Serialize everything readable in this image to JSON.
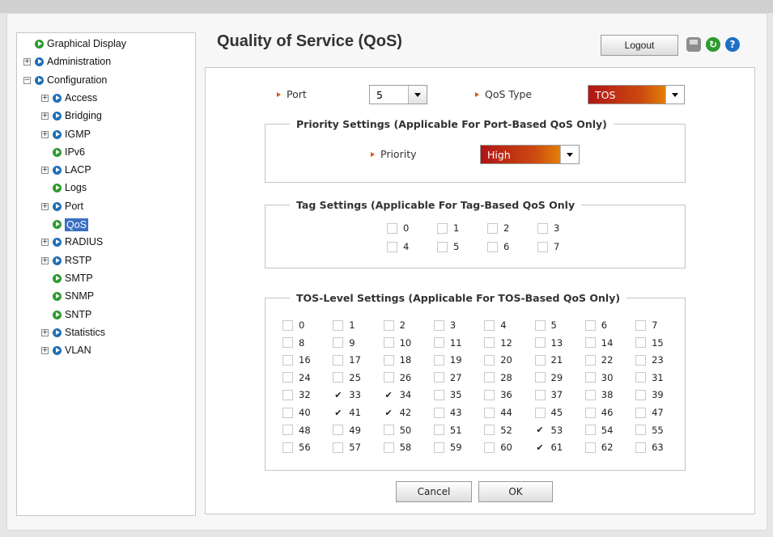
{
  "nav": {
    "items": [
      {
        "label": "Graphical Display",
        "icon": "green-bullet",
        "expander": "",
        "selected": false
      },
      {
        "label": "Administration",
        "icon": "blue-bullet",
        "expander": "+",
        "selected": false
      },
      {
        "label": "Configuration",
        "icon": "blue-bullet",
        "expander": "−",
        "selected": false
      },
      {
        "label": "Access",
        "icon": "blue-bullet",
        "expander": "+",
        "selected": false
      },
      {
        "label": "Bridging",
        "icon": "blue-bullet",
        "expander": "+",
        "selected": false
      },
      {
        "label": "IGMP",
        "icon": "blue-bullet",
        "expander": "+",
        "selected": false
      },
      {
        "label": "IPv6",
        "icon": "green-bullet",
        "expander": "",
        "selected": false
      },
      {
        "label": "LACP",
        "icon": "blue-bullet",
        "expander": "+",
        "selected": false
      },
      {
        "label": "Logs",
        "icon": "green-bullet",
        "expander": "",
        "selected": false
      },
      {
        "label": "Port",
        "icon": "blue-bullet",
        "expander": "+",
        "selected": false
      },
      {
        "label": "QoS",
        "icon": "green-bullet",
        "expander": "",
        "selected": true
      },
      {
        "label": "RADIUS",
        "icon": "blue-bullet",
        "expander": "+",
        "selected": false
      },
      {
        "label": "RSTP",
        "icon": "blue-bullet",
        "expander": "+",
        "selected": false
      },
      {
        "label": "SMTP",
        "icon": "green-bullet",
        "expander": "",
        "selected": false
      },
      {
        "label": "SNMP",
        "icon": "green-bullet",
        "expander": "",
        "selected": false
      },
      {
        "label": "SNTP",
        "icon": "green-bullet",
        "expander": "",
        "selected": false
      },
      {
        "label": "Statistics",
        "icon": "blue-bullet",
        "expander": "+",
        "selected": false
      },
      {
        "label": "VLAN",
        "icon": "blue-bullet",
        "expander": "+",
        "selected": false
      }
    ]
  },
  "header": {
    "title": "Quality of Service (QoS)",
    "logout_label": "Logout",
    "icons": [
      "save-icon",
      "refresh-icon",
      "help-icon"
    ]
  },
  "form": {
    "port_label": "Port",
    "port_value": "5",
    "qos_type_label": "QoS Type",
    "qos_type_value": "TOS",
    "priority_group_title": "Priority Settings (Applicable For Port-Based QoS Only)",
    "priority_label": "Priority",
    "priority_value": "High",
    "tag_group_title": "Tag Settings (Applicable For Tag-Based QoS Only",
    "tags": [
      {
        "label": "0",
        "checked": false
      },
      {
        "label": "1",
        "checked": false
      },
      {
        "label": "2",
        "checked": false
      },
      {
        "label": "3",
        "checked": false
      },
      {
        "label": "4",
        "checked": false
      },
      {
        "label": "5",
        "checked": false
      },
      {
        "label": "6",
        "checked": false
      },
      {
        "label": "7",
        "checked": false
      }
    ],
    "tos_group_title": "TOS-Level Settings (Applicable For TOS-Based QoS Only)",
    "tos_levels": [
      {
        "label": "0",
        "checked": false
      },
      {
        "label": "1",
        "checked": false
      },
      {
        "label": "2",
        "checked": false
      },
      {
        "label": "3",
        "checked": false
      },
      {
        "label": "4",
        "checked": false
      },
      {
        "label": "5",
        "checked": false
      },
      {
        "label": "6",
        "checked": false
      },
      {
        "label": "7",
        "checked": false
      },
      {
        "label": "8",
        "checked": false
      },
      {
        "label": "9",
        "checked": false
      },
      {
        "label": "10",
        "checked": false
      },
      {
        "label": "11",
        "checked": false
      },
      {
        "label": "12",
        "checked": false
      },
      {
        "label": "13",
        "checked": false
      },
      {
        "label": "14",
        "checked": false
      },
      {
        "label": "15",
        "checked": false
      },
      {
        "label": "16",
        "checked": false
      },
      {
        "label": "17",
        "checked": false
      },
      {
        "label": "18",
        "checked": false
      },
      {
        "label": "19",
        "checked": false
      },
      {
        "label": "20",
        "checked": false
      },
      {
        "label": "21",
        "checked": false
      },
      {
        "label": "22",
        "checked": false
      },
      {
        "label": "23",
        "checked": false
      },
      {
        "label": "24",
        "checked": false
      },
      {
        "label": "25",
        "checked": false
      },
      {
        "label": "26",
        "checked": false
      },
      {
        "label": "27",
        "checked": false
      },
      {
        "label": "28",
        "checked": false
      },
      {
        "label": "29",
        "checked": false
      },
      {
        "label": "30",
        "checked": false
      },
      {
        "label": "31",
        "checked": false
      },
      {
        "label": "32",
        "checked": false
      },
      {
        "label": "33",
        "checked": true
      },
      {
        "label": "34",
        "checked": true
      },
      {
        "label": "35",
        "checked": false
      },
      {
        "label": "36",
        "checked": false
      },
      {
        "label": "37",
        "checked": false
      },
      {
        "label": "38",
        "checked": false
      },
      {
        "label": "39",
        "checked": false
      },
      {
        "label": "40",
        "checked": false
      },
      {
        "label": "41",
        "checked": true
      },
      {
        "label": "42",
        "checked": true
      },
      {
        "label": "43",
        "checked": false
      },
      {
        "label": "44",
        "checked": false
      },
      {
        "label": "45",
        "checked": false
      },
      {
        "label": "46",
        "checked": false
      },
      {
        "label": "47",
        "checked": false
      },
      {
        "label": "48",
        "checked": false
      },
      {
        "label": "49",
        "checked": false
      },
      {
        "label": "50",
        "checked": false
      },
      {
        "label": "51",
        "checked": false
      },
      {
        "label": "52",
        "checked": false
      },
      {
        "label": "53",
        "checked": true
      },
      {
        "label": "54",
        "checked": false
      },
      {
        "label": "55",
        "checked": false
      },
      {
        "label": "56",
        "checked": false
      },
      {
        "label": "57",
        "checked": false
      },
      {
        "label": "58",
        "checked": false
      },
      {
        "label": "59",
        "checked": false
      },
      {
        "label": "60",
        "checked": false
      },
      {
        "label": "61",
        "checked": true
      },
      {
        "label": "62",
        "checked": false
      },
      {
        "label": "63",
        "checked": false
      }
    ],
    "cancel_label": "Cancel",
    "ok_label": "OK"
  },
  "colors": {
    "accent_blue": "#1f6fb5",
    "accent_green": "#2e9a2e",
    "selection": "#3a6fc4",
    "arrow_orange": "#d35a1a"
  }
}
